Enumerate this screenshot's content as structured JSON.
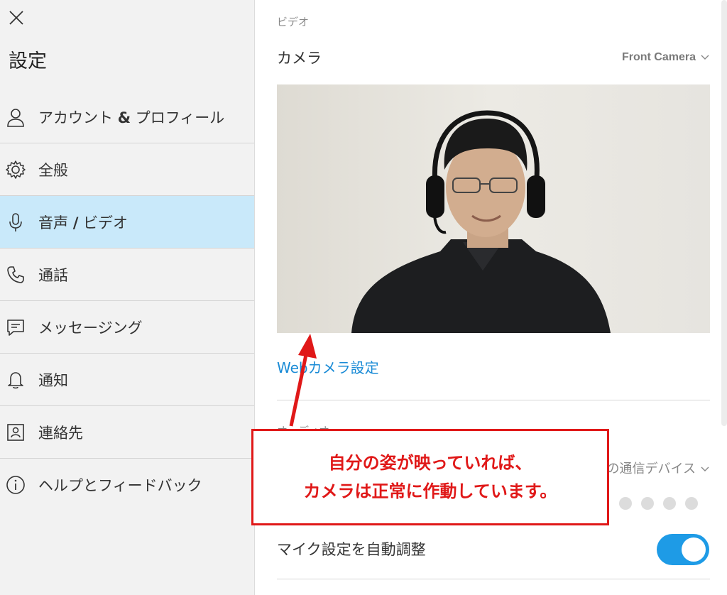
{
  "sidebar": {
    "close_icon": "close-icon",
    "title": "設定",
    "items": [
      {
        "label_pre": "アカウント ",
        "label_bold": "&",
        "label_post": " プロフィール",
        "icon": "person-icon",
        "active": false
      },
      {
        "label": "全般",
        "icon": "gear-icon",
        "active": false
      },
      {
        "label_pre": "音声 ",
        "label_bold": "/",
        "label_post": " ビデオ",
        "icon": "microphone-icon",
        "active": true
      },
      {
        "label": "通話",
        "icon": "phone-icon",
        "active": false
      },
      {
        "label": "メッセージング",
        "icon": "message-icon",
        "active": false
      },
      {
        "label": "通知",
        "icon": "bell-icon",
        "active": false
      },
      {
        "label": "連絡先",
        "icon": "contact-card-icon",
        "active": false
      },
      {
        "label": "ヘルプとフィードバック",
        "icon": "info-icon",
        "active": false
      }
    ]
  },
  "video": {
    "section_label": "ビデオ",
    "camera_label": "カメラ",
    "camera_value": "Front Camera",
    "webcam_settings_link": "Webカメラ設定"
  },
  "audio": {
    "section_label": "オーディオ",
    "device_value": "の通信デバイス",
    "auto_adjust_label": "マイク設定を自動調整",
    "auto_adjust_on": true
  },
  "annotation": {
    "line1": "自分の姿が映っていれば、",
    "line2": "カメラは正常に作動しています。",
    "color": "#e01818"
  },
  "colors": {
    "accent": "#1e9be6",
    "active_nav": "#c9e9fa",
    "link": "#1a8bd6"
  }
}
